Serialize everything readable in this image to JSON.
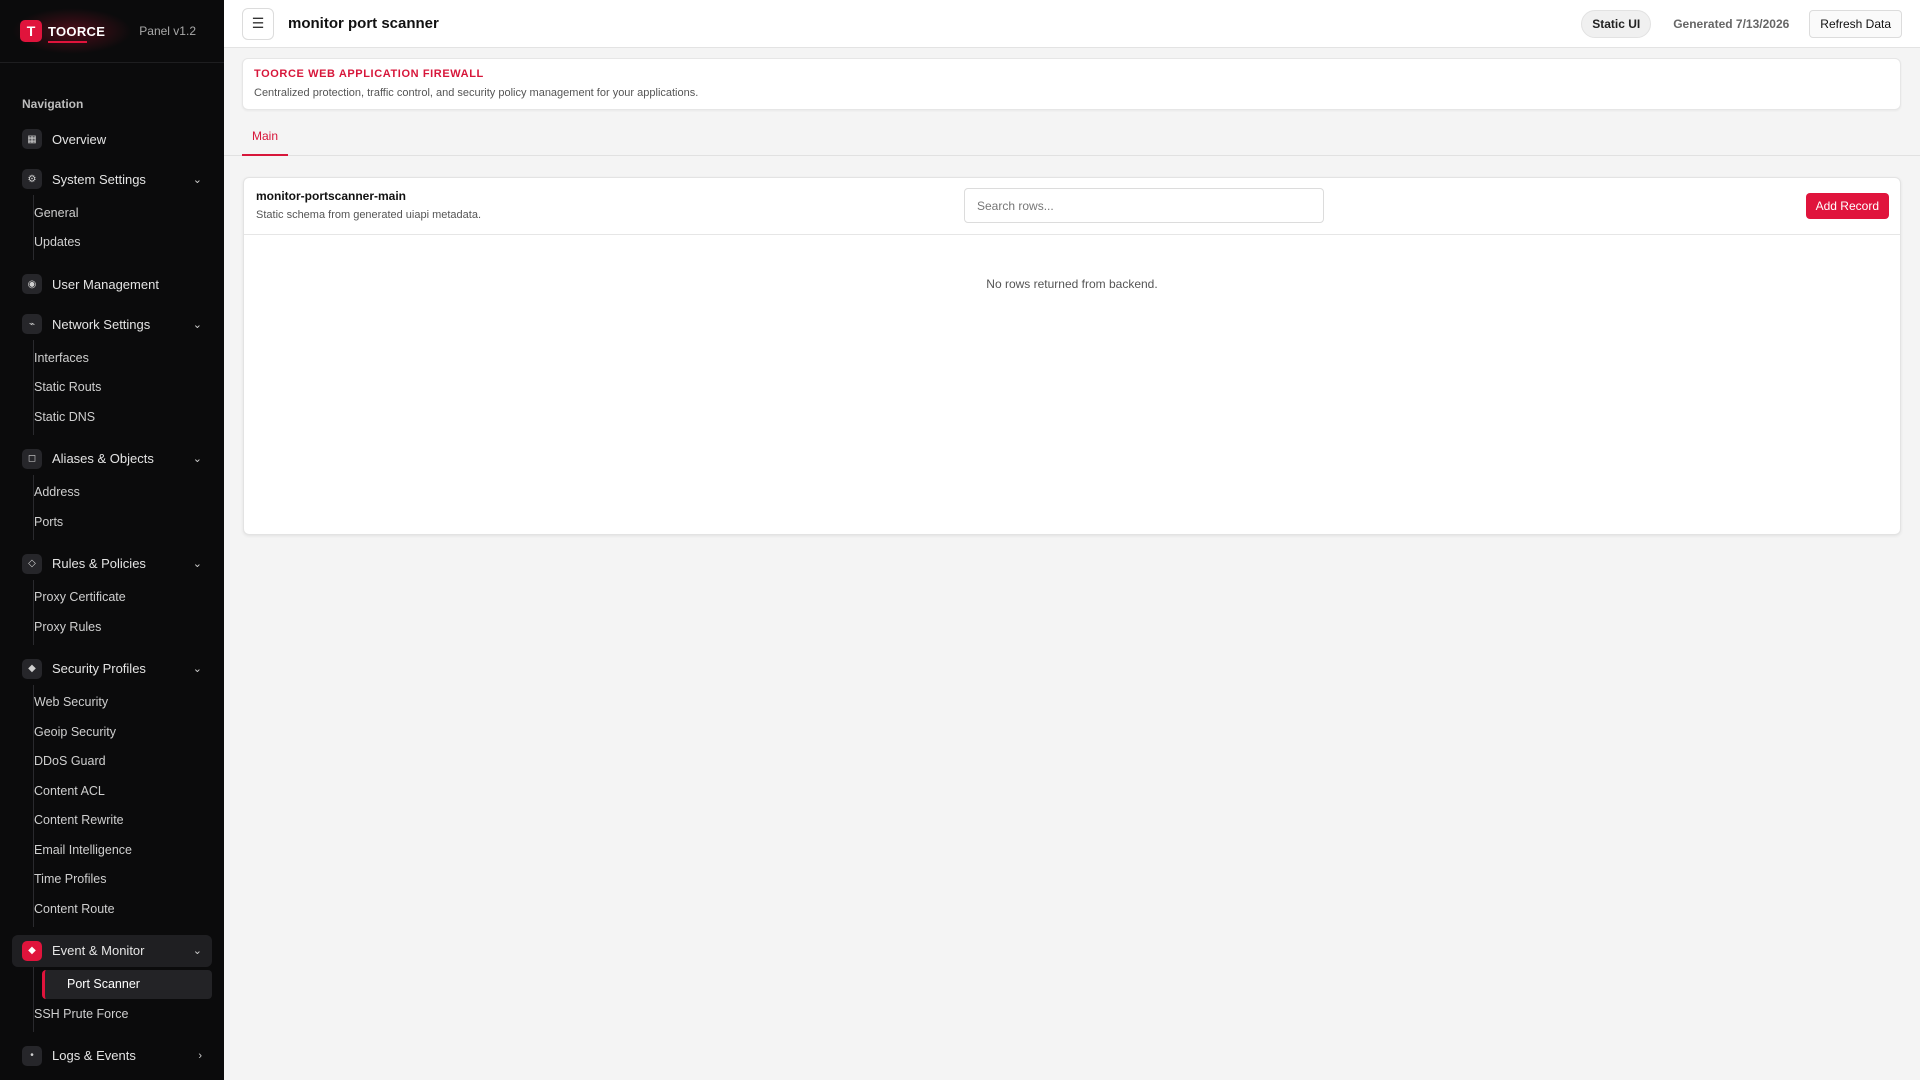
{
  "brand": {
    "logo_letter": "T",
    "name": "TOORCE",
    "version": "Panel v1.2",
    "accent": "#e0143c"
  },
  "nav": {
    "heading": "Navigation",
    "overview": "Overview",
    "system_settings": {
      "label": "System Settings",
      "items": [
        "General",
        "Updates"
      ]
    },
    "user_management": "User Management",
    "network_settings": {
      "label": "Network Settings",
      "items": [
        "Interfaces",
        "Static Routs",
        "Static DNS"
      ]
    },
    "aliases_objects": {
      "label": "Aliases & Objects",
      "items": [
        "Address",
        "Ports"
      ]
    },
    "rules_policies": {
      "label": "Rules & Policies",
      "items": [
        "Proxy Certificate",
        "Proxy Rules"
      ]
    },
    "security_profiles": {
      "label": "Security Profiles",
      "items": [
        "Web Security",
        "Geoip Security",
        "DDoS Guard",
        "Content ACL",
        "Content Rewrite",
        "Email Intelligence",
        "Time Profiles",
        "Content Route"
      ]
    },
    "event_monitor": {
      "label": "Event & Monitor",
      "items": [
        "Port Scanner",
        "SSH Prute Force"
      ]
    },
    "logs_events": "Logs & Events"
  },
  "topbar": {
    "menu_icon": "☰",
    "title": "monitor port scanner",
    "static_ui": "Static UI",
    "generated": "Generated 7/13/2026",
    "refresh": "Refresh Data"
  },
  "banner": {
    "title": "TOORCE WEB APPLICATION FIREWALL",
    "description": "Centralized protection, traffic control, and security policy management for your applications."
  },
  "tabs": [
    "Main"
  ],
  "table_card": {
    "title": "monitor-portscanner-main",
    "subtitle": "Static schema from generated uiapi metadata.",
    "search_placeholder": "Search rows...",
    "add_button": "Add Record",
    "empty_message": "No rows returned from backend."
  }
}
